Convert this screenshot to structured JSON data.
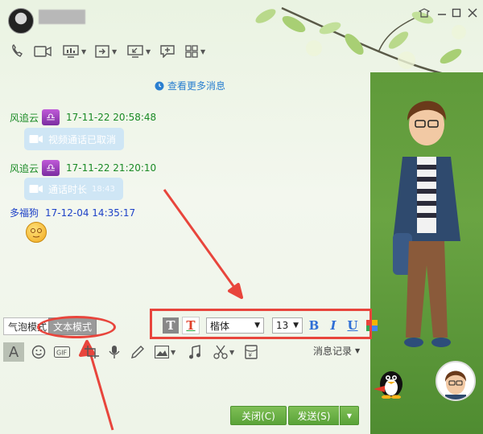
{
  "titlebar": {
    "nickname": "",
    "controls": [
      "dress-icon",
      "minimize-icon",
      "maximize-icon",
      "close-icon"
    ]
  },
  "chat": {
    "more_messages": "查看更多消息",
    "messages": [
      {
        "sender": "风追云",
        "time": "17-11-22 20:58:48",
        "bubble": "视频通话已取消",
        "duration": ""
      },
      {
        "sender": "风追云",
        "time": "17-11-22 21:20:10",
        "bubble": "通话时长",
        "duration": "18:43"
      },
      {
        "sender": "多福狗",
        "time": "17-12-04 14:35:17"
      }
    ]
  },
  "mode": {
    "bubble_label": "气泡模式",
    "text_label": "文本模式"
  },
  "font_bar": {
    "font_name": "楷体",
    "font_size": "13",
    "bold": "B",
    "italic": "I",
    "underline": "U"
  },
  "bottom": {
    "history_label": "消息记录",
    "close_label": "关闭(C)",
    "send_label": "发送(S)"
  },
  "colors": {
    "accent_green": "#5aa338",
    "name_green": "#1a8a25",
    "name_blue": "#1f43c8",
    "link_blue": "#2a7fd0",
    "annotation_red": "#e8453c"
  }
}
